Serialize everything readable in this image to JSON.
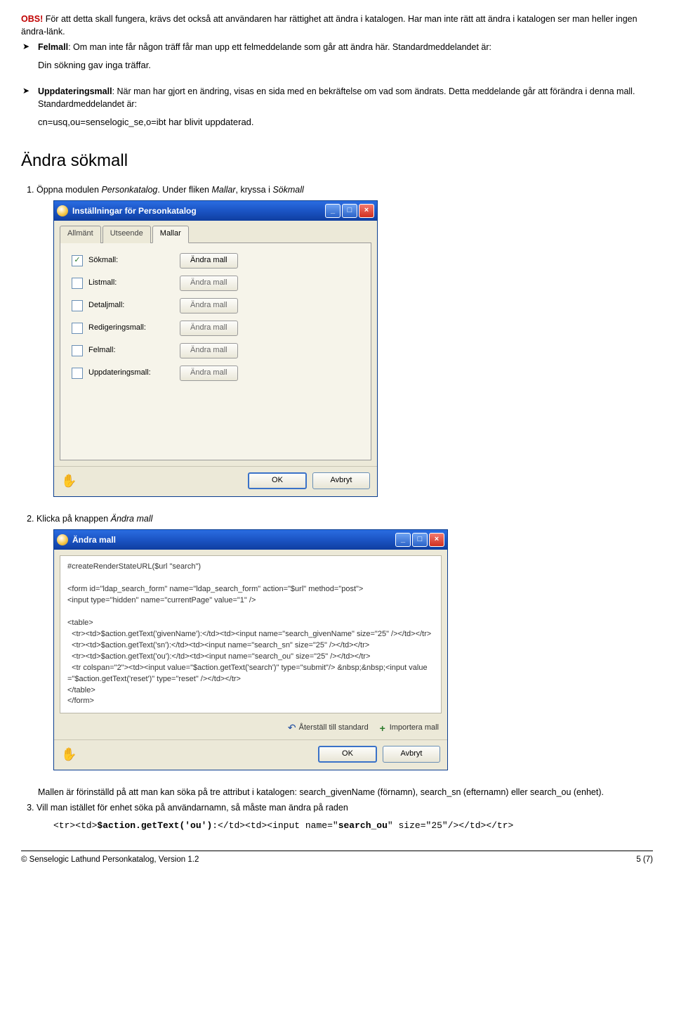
{
  "intro": {
    "obs_label": "OBS!",
    "obs_text": " För att detta skall fungera, krävs det också att användaren har rättighet att ändra i katalogen. Har man inte rätt att ändra i katalogen ser man heller ingen ändra-länk."
  },
  "bullets": {
    "felmall_label": "Felmall",
    "felmall_text": ": Om man inte får någon träff får man upp ett felmeddelande som går att ändra här. Standardmeddelandet är:",
    "felmall_msg": "Din sökning gav inga träffar.",
    "uppd_label": "Uppdateringsmall",
    "uppd_text": ": När man har gjort en ändring, visas en sida med en bekräftelse om vad som ändrats. Detta meddelande går att förändra i denna mall. Standardmeddelandet är:",
    "uppd_msg": "cn=usq,ou=senselogic_se,o=ibt har blivit uppdaterad."
  },
  "heading": "Ändra sökmall",
  "step1_pre": "Öppna modulen ",
  "step1_mod": "Personkatalog",
  "step1_mid": ". Under fliken ",
  "step1_flik": "Mallar",
  "step1_post": ", kryssa i ",
  "step1_last": "Sökmall",
  "dialog1": {
    "title": "Inställningar för Personkatalog",
    "tabs": {
      "t1": "Allmänt",
      "t2": "Utseende",
      "t3": "Mallar"
    },
    "rows": [
      {
        "label": "Sökmall:",
        "checked": true,
        "btn": "Ändra mall",
        "enabled": true
      },
      {
        "label": "Listmall:",
        "checked": false,
        "btn": "Ändra mall",
        "enabled": false
      },
      {
        "label": "Detaljmall:",
        "checked": false,
        "btn": "Ändra mall",
        "enabled": false
      },
      {
        "label": "Redigeringsmall:",
        "checked": false,
        "btn": "Ändra mall",
        "enabled": false
      },
      {
        "label": "Felmall:",
        "checked": false,
        "btn": "Ändra mall",
        "enabled": false
      },
      {
        "label": "Uppdateringsmall:",
        "checked": false,
        "btn": "Ändra mall",
        "enabled": false
      }
    ],
    "ok": "OK",
    "cancel": "Avbryt"
  },
  "step2_pre": "Klicka på knappen ",
  "step2_btn": "Ändra mall",
  "dialog2": {
    "title": "Ändra mall",
    "code": "#createRenderStateURL($url \"search\")\n\n<form id=\"ldap_search_form\" name=\"ldap_search_form\" action=\"$url\" method=\"post\">\n<input type=\"hidden\" name=\"currentPage\" value=\"1\" />\n\n<table>\n  <tr><td>$action.getText('givenName'):</td><td><input name=\"search_givenName\" size=\"25\" /></td></tr>\n  <tr><td>$action.getText('sn'):</td><td><input name=\"search_sn\" size=\"25\" /></td></tr>\n  <tr><td>$action.getText('ou'):</td><td><input name=\"search_ou\" size=\"25\" /></td></tr>\n  <tr colspan=\"2\"><td><input value=\"$action.getText('search')\" type=\"submit\"/> &nbsp;&nbsp;<input value=\"$action.getText('reset')\" type=\"reset\" /></td></tr>\n</table>\n</form>",
    "reset_link": "Återställ till standard",
    "import_link": "Importera mall",
    "ok": "OK",
    "cancel": "Avbryt"
  },
  "after": {
    "p1": "Mallen är förinställd på att man kan söka på tre attribut i katalogen: search_givenName (förnamn), search_sn (efternamn) eller search_ou (enhet).",
    "step3": "Vill man istället för enhet söka på användarnamn, så måste man ändra på raden",
    "code_pre": "<tr><td>",
    "code_hl1": "$action.getText('ou')",
    "code_mid": ":</td><td><input name=\"",
    "code_hl2": "search_ou",
    "code_post": "\" size=\"25\"/></td></tr>"
  },
  "footer": {
    "left": "© Senselogic Lathund Personkatalog, Version 1.2",
    "right": "5 (7)"
  }
}
